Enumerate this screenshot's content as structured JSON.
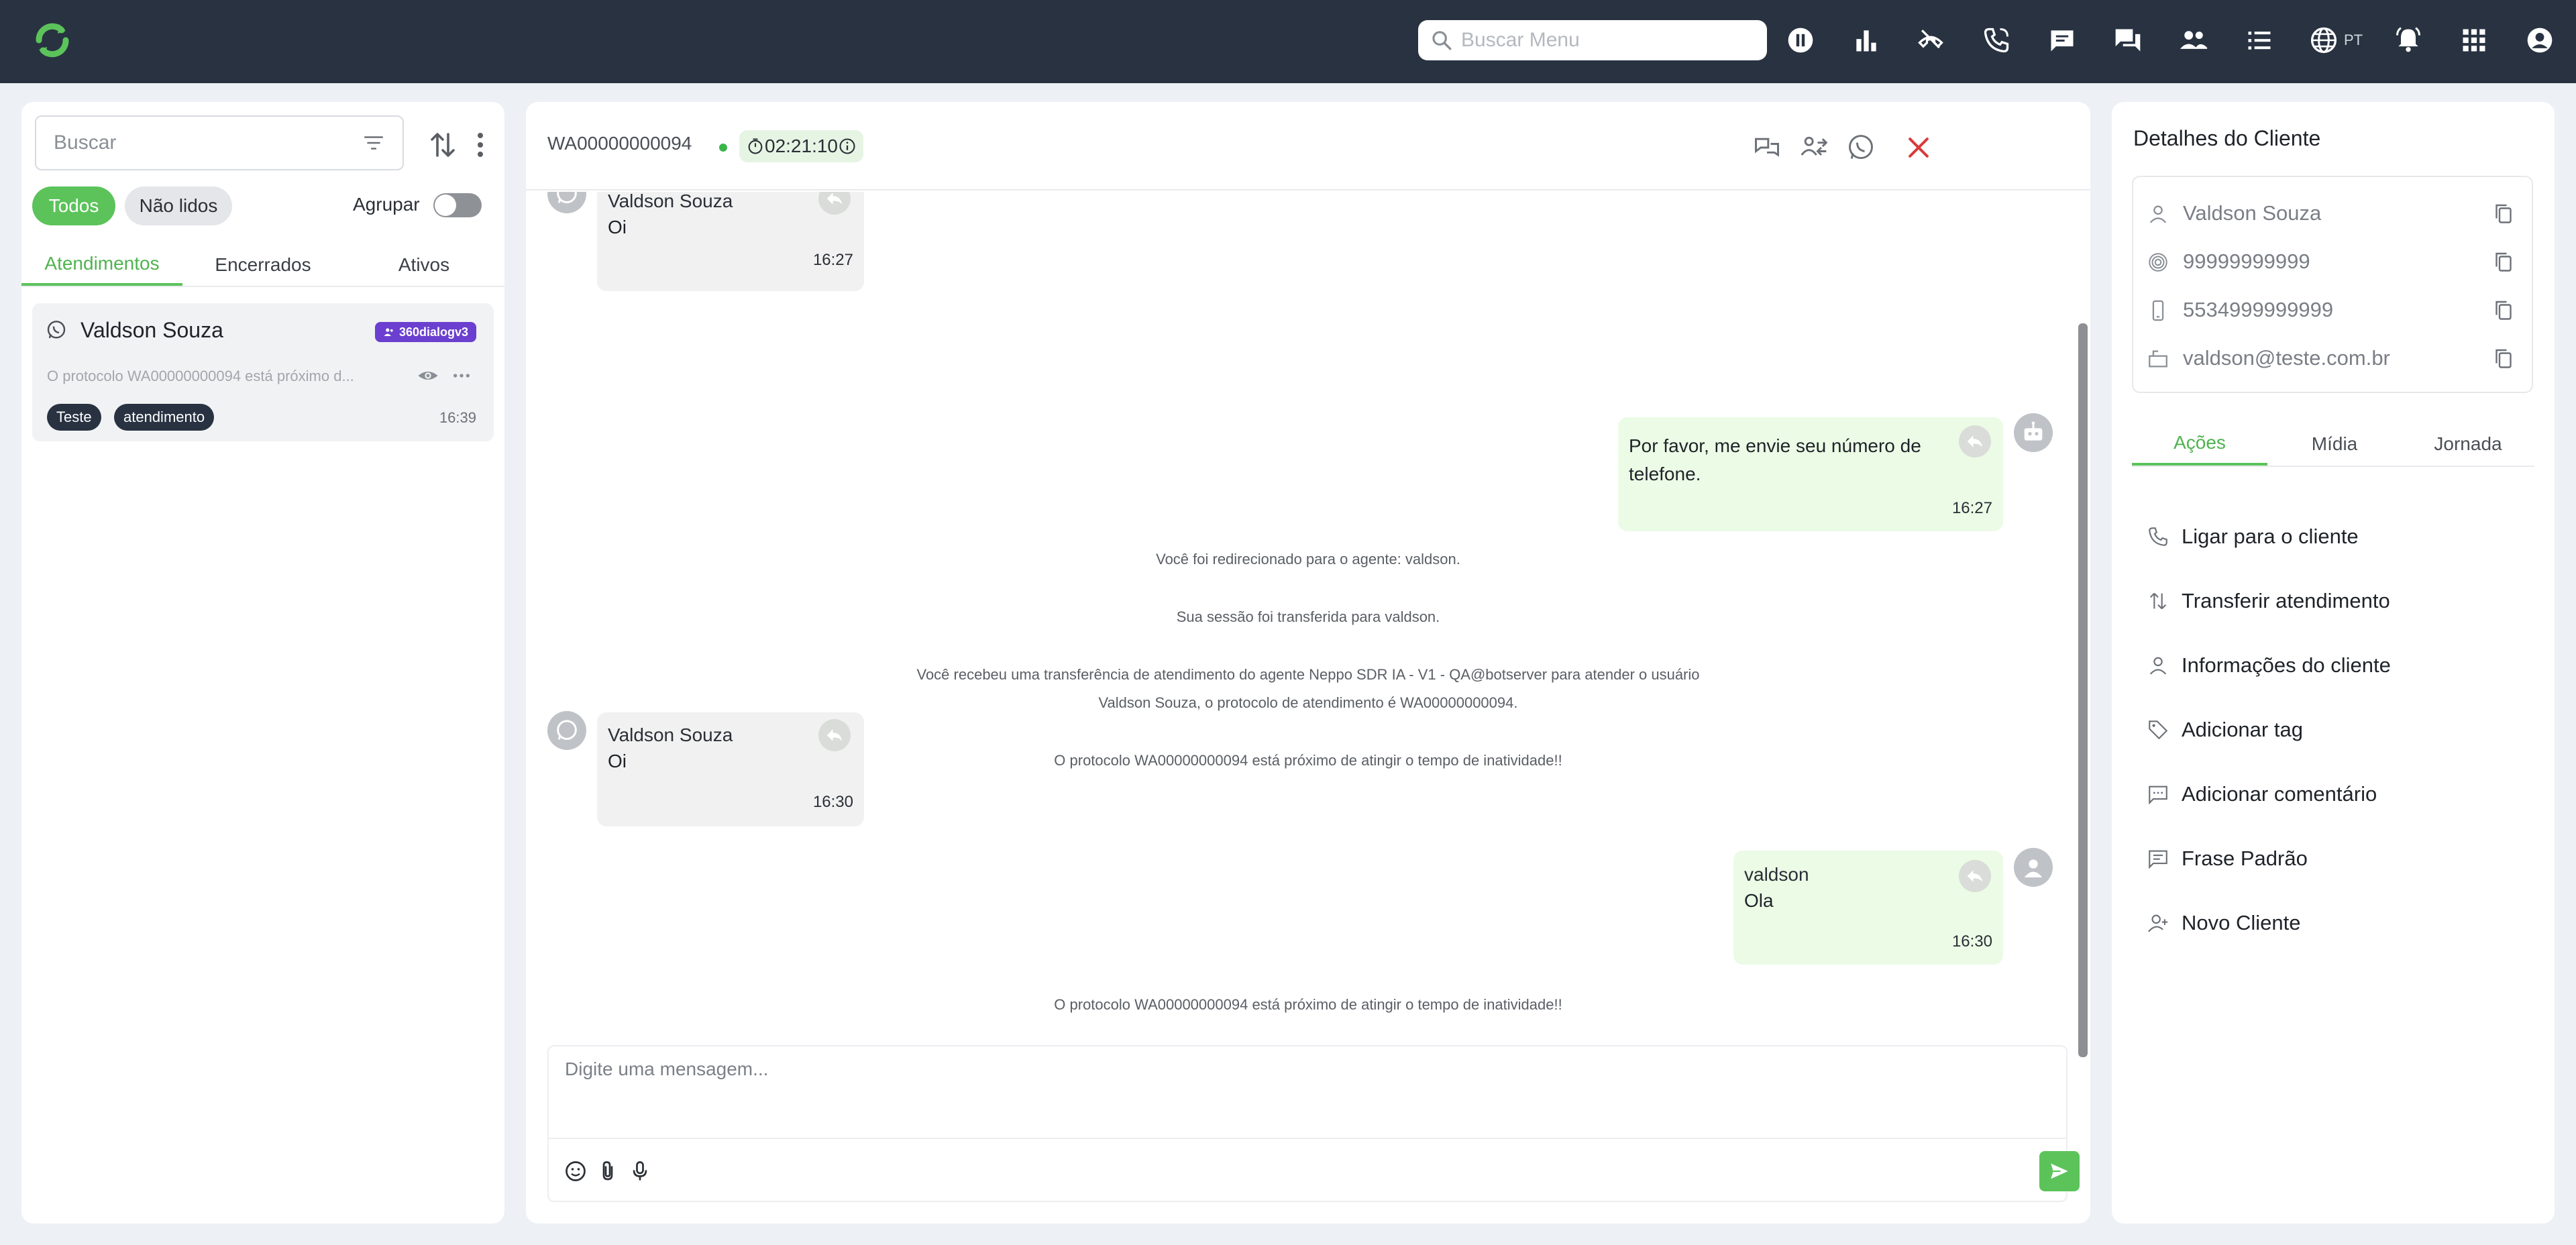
{
  "colors": {
    "topbar": "#283241",
    "accent": "#5cc35b",
    "badge": "#6b3fcf",
    "close": "#d93b3b"
  },
  "topbar": {
    "search_placeholder": "Buscar Menu",
    "lang": "PT",
    "icons": [
      "pause-icon",
      "bar-chart-icon",
      "call-end-icon",
      "phone-icon",
      "chat-icon",
      "forum-icon",
      "people-icon",
      "list-icon",
      "globe-icon",
      "bell-icon",
      "apps-icon",
      "account-icon"
    ]
  },
  "left": {
    "search_placeholder": "Buscar",
    "filter_all": "Todos",
    "filter_unread": "Não lidos",
    "group_label": "Agrupar",
    "tabs": [
      "Atendimentos",
      "Encerrados",
      "Ativos"
    ],
    "card": {
      "name": "Valdson Souza",
      "badge": "360dialogv3",
      "preview": "O protocolo WA00000000094 está próximo d...",
      "tags": [
        "Teste",
        "atendimento"
      ],
      "time": "16:39"
    }
  },
  "chat": {
    "protocol": "WA00000000094",
    "timer": "02:21:10",
    "messages": [
      {
        "name": "Valdson Souza",
        "text": "Oi",
        "time": "16:27"
      },
      {
        "text1": "Por favor, me envie seu número de",
        "text2": "telefone.",
        "time": "16:27"
      },
      {
        "name": "Valdson Souza",
        "text": "Oi",
        "time": "16:30"
      },
      {
        "name": "valdson",
        "text": "Ola",
        "time": "16:30"
      }
    ],
    "system": [
      "Você foi redirecionado para o agente: valdson.",
      "Sua sessão foi transferida para valdson.",
      "Você recebeu uma transferência de atendimento do agente Neppo SDR IA - V1 - QA@botserver para atender o usuário",
      "Valdson Souza, o protocolo de atendimento é WA00000000094.",
      "O protocolo WA00000000094 está próximo de atingir o tempo de inatividade!!",
      "O protocolo WA00000000094 está próximo de atingir o tempo de inatividade!!"
    ],
    "input_placeholder": "Digite uma mensagem..."
  },
  "right": {
    "title": "Detalhes do Cliente",
    "name": "Valdson Souza",
    "document": "99999999999",
    "phone": "5534999999999",
    "email": "valdson@teste.com.br",
    "tabs": [
      "Ações",
      "Mídia",
      "Jornada"
    ],
    "actions": [
      "Ligar para o cliente",
      "Transferir atendimento",
      "Informações do cliente",
      "Adicionar tag",
      "Adicionar comentário",
      "Frase Padrão",
      "Novo Cliente"
    ]
  }
}
